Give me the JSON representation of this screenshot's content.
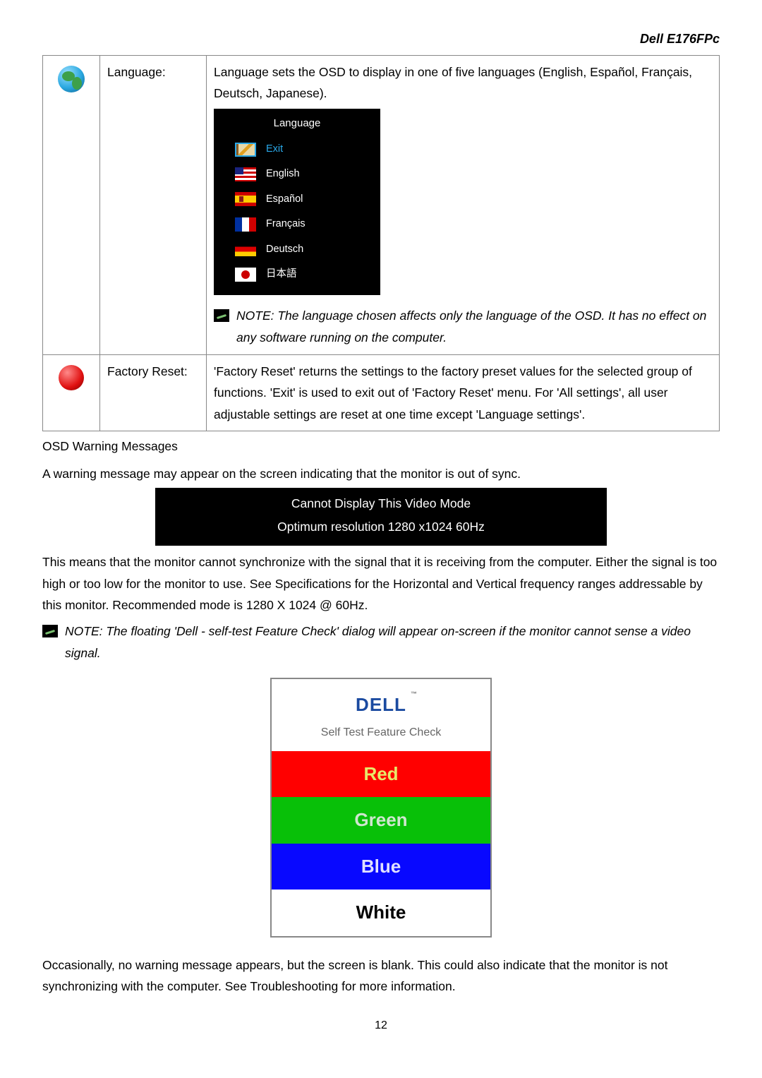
{
  "header": {
    "title": "Dell E176FPc"
  },
  "table": {
    "rows": [
      {
        "icon": "globe",
        "label": "Language:",
        "desc": "Language sets the OSD to display in one of five languages (English, Español, Français, Deutsch, Japanese).",
        "panel_title": "Language",
        "langs": [
          {
            "flag": "exit",
            "text": "Exit",
            "selected": true
          },
          {
            "flag": "us",
            "text": "English"
          },
          {
            "flag": "es",
            "text": "Español"
          },
          {
            "flag": "fr",
            "text": "Français"
          },
          {
            "flag": "de",
            "text": "Deutsch"
          },
          {
            "flag": "jp",
            "text": "日本語"
          }
        ],
        "note": "NOTE: The language chosen affects only the language of the OSD. It has no effect on any software running on the computer."
      },
      {
        "icon": "red-dot",
        "label": "Factory Reset:",
        "desc": "'Factory Reset' returns the settings to the factory preset values for the selected group of functions. 'Exit' is used to exit out of 'Factory Reset' menu. For 'All settings', all user adjustable settings are reset at one time except 'Language settings'."
      }
    ]
  },
  "warnings": {
    "heading": "OSD Warning Messages",
    "intro": "A warning message may appear on the screen indicating that the monitor is out of sync.",
    "box_line1": "Cannot Display This Video Mode",
    "box_line2": "Optimum resolution 1280 x1024 60Hz",
    "explain": "This means that the monitor cannot synchronize with the signal that it is receiving from the computer. Either the signal is too high or too low for the monitor to use. See Specifications for the Horizontal and Vertical frequency ranges addressable by this monitor. Recommended mode is 1280 X 1024 @ 60Hz.",
    "note": "NOTE: The floating 'Dell - self-test Feature Check' dialog will appear on-screen if the monitor cannot sense a video signal."
  },
  "stfc": {
    "logo": "DELL",
    "tm": "™",
    "subtitle": "Self Test Feature Check",
    "red": "Red",
    "green": "Green",
    "blue": "Blue",
    "white": "White"
  },
  "footer_para": "Occasionally, no warning message appears, but the screen is blank. This could also indicate that the monitor is not synchronizing with the computer. See Troubleshooting for more information.",
  "page_number": "12"
}
